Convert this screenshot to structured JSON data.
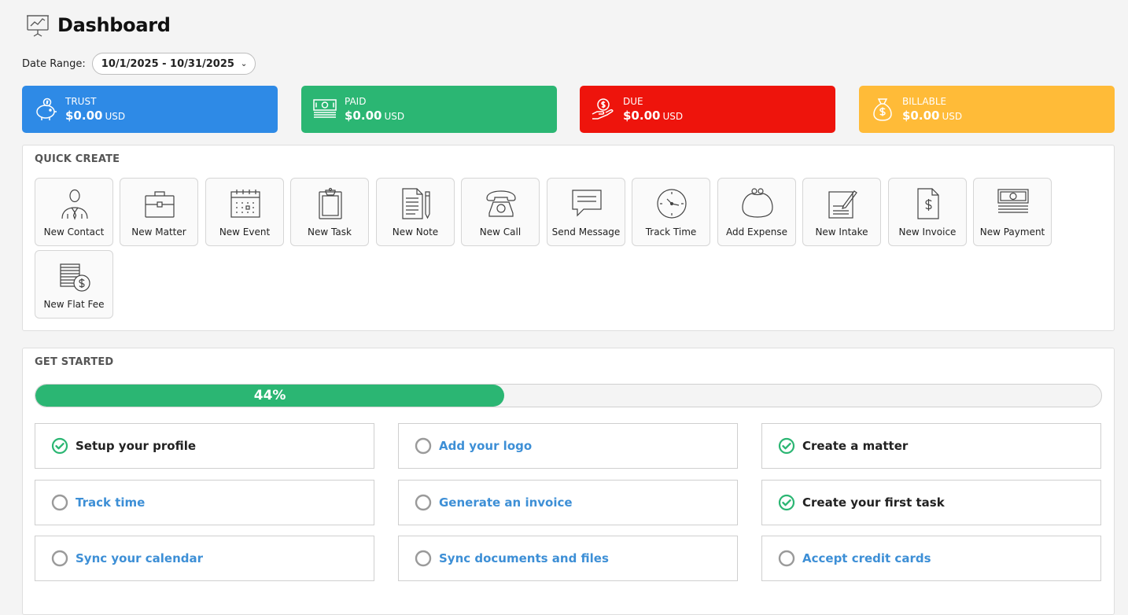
{
  "page": {
    "title": "Dashboard"
  },
  "date_range": {
    "label": "Date Range:",
    "value": "10/1/2025 - 10/31/2025"
  },
  "summary_cards": [
    {
      "title": "TRUST",
      "amount": "$0.00",
      "currency": "USD",
      "color": "#2e8ae6",
      "icon": "piggy-bank-icon"
    },
    {
      "title": "PAID",
      "amount": "$0.00",
      "currency": "USD",
      "color": "#2bb673",
      "icon": "banknote-icon"
    },
    {
      "title": "DUE",
      "amount": "$0.00",
      "currency": "USD",
      "color": "#ee140c",
      "icon": "hand-coin-icon"
    },
    {
      "title": "BILLABLE",
      "amount": "$0.00",
      "currency": "USD",
      "color": "#ffbb38",
      "icon": "money-bag-icon"
    }
  ],
  "quick_create": {
    "title": "QUICK CREATE",
    "items": [
      {
        "label": "New Contact",
        "icon": "contact-icon"
      },
      {
        "label": "New Matter",
        "icon": "briefcase-icon"
      },
      {
        "label": "New Event",
        "icon": "calendar-icon"
      },
      {
        "label": "New Task",
        "icon": "clipboard-icon"
      },
      {
        "label": "New Note",
        "icon": "note-icon"
      },
      {
        "label": "New Call",
        "icon": "phone-icon"
      },
      {
        "label": "Send Message",
        "icon": "message-icon"
      },
      {
        "label": "Track Time",
        "icon": "clock-icon"
      },
      {
        "label": "Add Expense",
        "icon": "purse-icon"
      },
      {
        "label": "New Intake",
        "icon": "intake-icon"
      },
      {
        "label": "New Invoice",
        "icon": "invoice-icon"
      },
      {
        "label": "New Payment",
        "icon": "payment-icon"
      },
      {
        "label": "New Flat Fee",
        "icon": "flat-fee-icon"
      }
    ]
  },
  "get_started": {
    "title": "GET STARTED",
    "progress_percent": 44,
    "progress_label": "44%",
    "tasks": [
      {
        "label": "Setup your profile",
        "done": true
      },
      {
        "label": "Add your logo",
        "done": false
      },
      {
        "label": "Create a matter",
        "done": true
      },
      {
        "label": "Track time",
        "done": false
      },
      {
        "label": "Generate an invoice",
        "done": false
      },
      {
        "label": "Create your first task",
        "done": true
      },
      {
        "label": "Sync your calendar",
        "done": false
      },
      {
        "label": "Sync documents and files",
        "done": false
      },
      {
        "label": "Accept credit cards",
        "done": false
      }
    ],
    "colors": {
      "done": "#2bb673",
      "todo_ring": "#9a9a9a",
      "link": "#3d8fd6"
    }
  }
}
